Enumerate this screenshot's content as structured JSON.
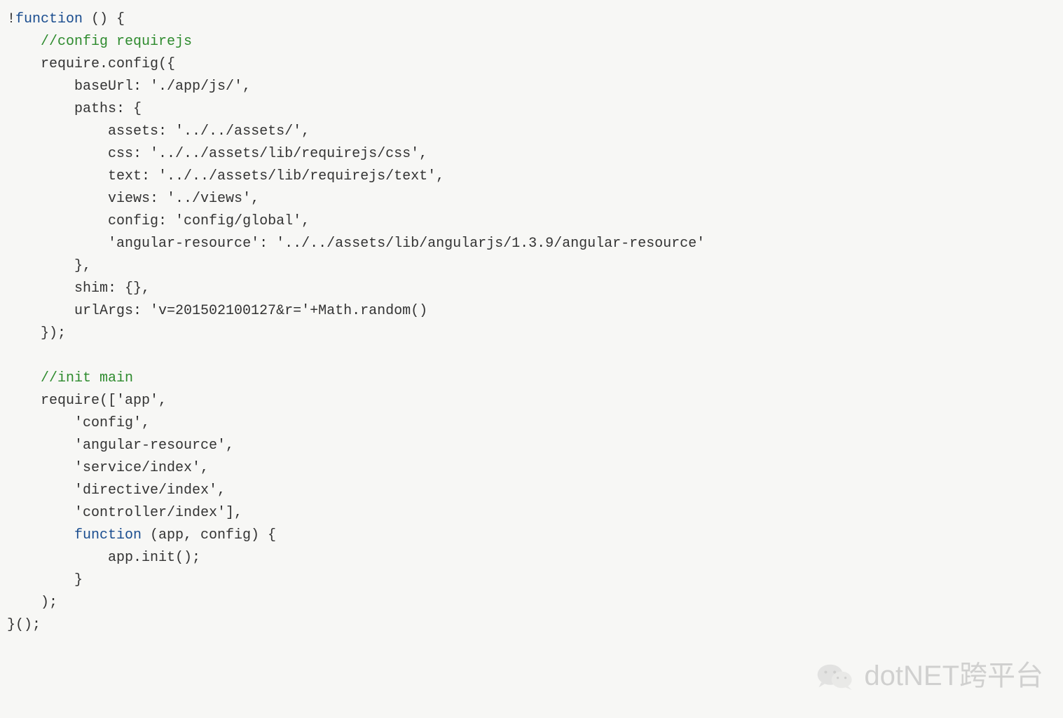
{
  "code": {
    "lines": [
      {
        "indent": 0,
        "parts": [
          {
            "t": "!",
            "c": "punct"
          },
          {
            "t": "function",
            "c": "keyword"
          },
          {
            "t": " () {",
            "c": "punct"
          }
        ]
      },
      {
        "indent": 1,
        "parts": [
          {
            "t": "//config requirejs",
            "c": "comment"
          }
        ]
      },
      {
        "indent": 1,
        "parts": [
          {
            "t": "require.config({",
            "c": "punct"
          }
        ]
      },
      {
        "indent": 2,
        "parts": [
          {
            "t": "baseUrl: './app/js/',",
            "c": "punct"
          }
        ]
      },
      {
        "indent": 2,
        "parts": [
          {
            "t": "paths: {",
            "c": "punct"
          }
        ]
      },
      {
        "indent": 3,
        "parts": [
          {
            "t": "assets: '../../assets/',",
            "c": "punct"
          }
        ]
      },
      {
        "indent": 3,
        "parts": [
          {
            "t": "css: '../../assets/lib/requirejs/css',",
            "c": "punct"
          }
        ]
      },
      {
        "indent": 3,
        "parts": [
          {
            "t": "text: '../../assets/lib/requirejs/text',",
            "c": "punct"
          }
        ]
      },
      {
        "indent": 3,
        "parts": [
          {
            "t": "views: '../views',",
            "c": "punct"
          }
        ]
      },
      {
        "indent": 3,
        "parts": [
          {
            "t": "config: 'config/global',",
            "c": "punct"
          }
        ]
      },
      {
        "indent": 3,
        "parts": [
          {
            "t": "'angular-resource': '../../assets/lib/angularjs/1.3.9/angular-resource'",
            "c": "punct"
          }
        ]
      },
      {
        "indent": 2,
        "parts": [
          {
            "t": "},",
            "c": "punct"
          }
        ]
      },
      {
        "indent": 2,
        "parts": [
          {
            "t": "shim: {},",
            "c": "punct"
          }
        ]
      },
      {
        "indent": 2,
        "parts": [
          {
            "t": "urlArgs: 'v=201502100127&r='+Math.random()",
            "c": "punct"
          }
        ]
      },
      {
        "indent": 1,
        "parts": [
          {
            "t": "});",
            "c": "punct"
          }
        ]
      },
      {
        "indent": 0,
        "parts": [
          {
            "t": "",
            "c": "punct"
          }
        ]
      },
      {
        "indent": 1,
        "parts": [
          {
            "t": "//init main",
            "c": "comment"
          }
        ]
      },
      {
        "indent": 1,
        "parts": [
          {
            "t": "require(['app',",
            "c": "punct"
          }
        ]
      },
      {
        "indent": 2,
        "parts": [
          {
            "t": "'config',",
            "c": "punct"
          }
        ]
      },
      {
        "indent": 2,
        "parts": [
          {
            "t": "'angular-resource',",
            "c": "punct"
          }
        ]
      },
      {
        "indent": 2,
        "parts": [
          {
            "t": "'service/index',",
            "c": "punct"
          }
        ]
      },
      {
        "indent": 2,
        "parts": [
          {
            "t": "'directive/index',",
            "c": "punct"
          }
        ]
      },
      {
        "indent": 2,
        "parts": [
          {
            "t": "'controller/index'],",
            "c": "punct"
          }
        ]
      },
      {
        "indent": 2,
        "parts": [
          {
            "t": "function",
            "c": "keyword"
          },
          {
            "t": " (app, config) {",
            "c": "punct"
          }
        ]
      },
      {
        "indent": 3,
        "parts": [
          {
            "t": "app.init();",
            "c": "punct"
          }
        ]
      },
      {
        "indent": 2,
        "parts": [
          {
            "t": "}",
            "c": "punct"
          }
        ]
      },
      {
        "indent": 1,
        "parts": [
          {
            "t": ");",
            "c": "punct"
          }
        ]
      },
      {
        "indent": 0,
        "parts": [
          {
            "t": "}();",
            "c": "punct"
          }
        ]
      }
    ]
  },
  "watermark": {
    "text": "dotNET跨平台"
  }
}
